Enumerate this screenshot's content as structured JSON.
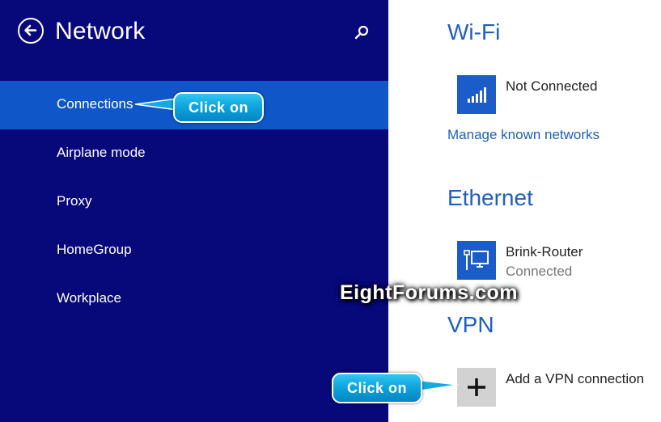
{
  "header": {
    "title": "Network",
    "back_icon": "back-arrow-icon",
    "search_icon": "search-icon"
  },
  "nav": {
    "items": [
      {
        "label": "Connections",
        "selected": true
      },
      {
        "label": "Airplane mode",
        "selected": false
      },
      {
        "label": "Proxy",
        "selected": false
      },
      {
        "label": "HomeGroup",
        "selected": false
      },
      {
        "label": "Workplace",
        "selected": false
      }
    ]
  },
  "wifi": {
    "title": "Wi-Fi",
    "status": "Not Connected",
    "manage_link": "Manage known networks",
    "icon": "wifi-signal-icon"
  },
  "ethernet": {
    "title": "Ethernet",
    "name": "Brink-Router",
    "status": "Connected",
    "icon": "ethernet-icon"
  },
  "vpn": {
    "title": "VPN",
    "add_label": "Add a VPN connection",
    "icon": "plus-icon"
  },
  "callouts": {
    "connections": "Click on",
    "vpn": "Click on"
  },
  "watermark": "EightForums.com",
  "colors": {
    "left_panel": "#07087a",
    "selected": "#0f56c9",
    "accent": "#1f5fbf",
    "tile": "#1a5cc8"
  }
}
